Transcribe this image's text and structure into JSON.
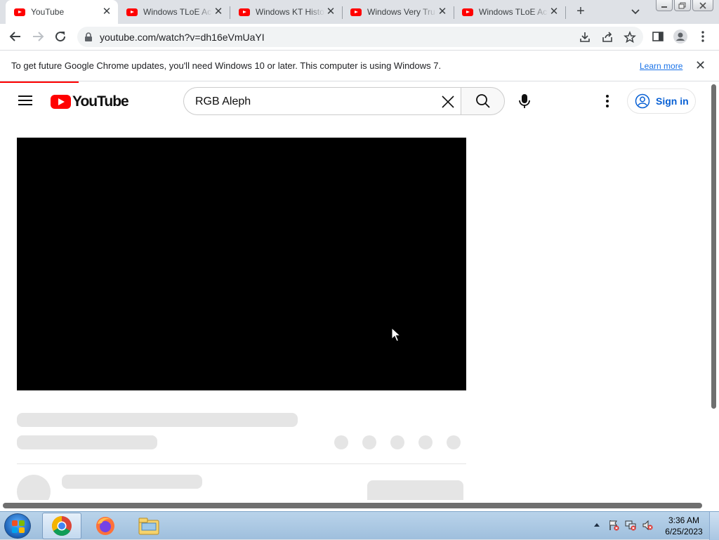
{
  "browser": {
    "tabs": [
      {
        "title": "YouTube",
        "active": true
      },
      {
        "title": "Windows TLoE Ac",
        "active": false
      },
      {
        "title": "Windows KT Histo",
        "active": false
      },
      {
        "title": "Windows Very Tru",
        "active": false
      },
      {
        "title": "Windows TLoE Ac",
        "active": false
      }
    ],
    "new_tab_label": "+",
    "tab_close_glyph": "✕",
    "url": "youtube.com/watch?v=dh16eVmUaYI"
  },
  "infobar": {
    "message": "To get future Google Chrome updates, you'll need Windows 10 or later. This computer is using Windows 7.",
    "link_label": "Learn more",
    "close_glyph": "✕"
  },
  "youtube": {
    "logo_text": "YouTube",
    "search_query": "RGB Aleph",
    "sign_in_label": "Sign in"
  },
  "taskbar": {
    "pinned": [
      "chrome-icon",
      "firefox-icon",
      "file-explorer-icon"
    ],
    "clock_time": "3:36 AM",
    "clock_date": "6/25/2023"
  },
  "colors": {
    "youtube_red": "#ff0000",
    "link_blue": "#1a73e8",
    "signin_blue": "#065fd4",
    "skeleton": "#e5e5e5"
  }
}
